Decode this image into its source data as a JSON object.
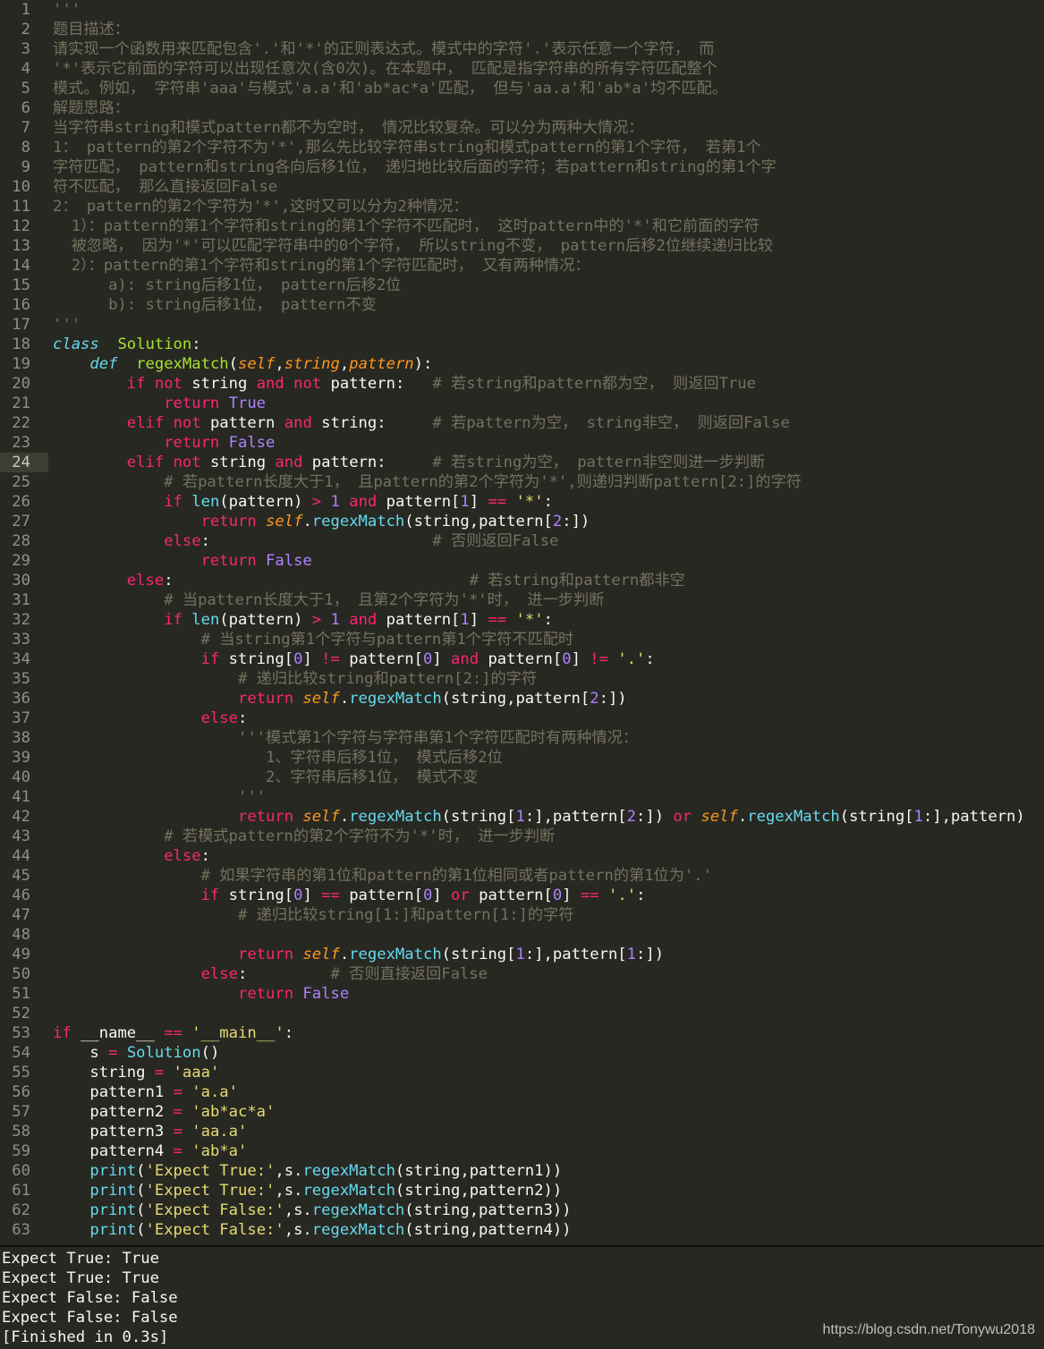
{
  "editor": {
    "current_line": 24,
    "lines": [
      [
        [
          "c",
          "'''"
        ]
      ],
      [
        [
          "c",
          "题目描述："
        ]
      ],
      [
        [
          "c",
          "请实现一个函数用来匹配包含'.'和'*'的正则表达式。模式中的字符'.'表示任意一个字符， 而"
        ]
      ],
      [
        [
          "c",
          "'*'表示它前面的字符可以出现任意次(含0次)。在本题中， 匹配是指字符串的所有字符匹配整个"
        ]
      ],
      [
        [
          "c",
          "模式。例如， 字符串'aaa'与模式'a.a'和'ab*ac*a'匹配， 但与'aa.a'和'ab*a'均不匹配。"
        ]
      ],
      [
        [
          "c",
          "解题思路："
        ]
      ],
      [
        [
          "c",
          "当字符串string和模式pattern都不为空时， 情况比较复杂。可以分为两种大情况："
        ]
      ],
      [
        [
          "c",
          "1： pattern的第2个字符不为'*',那么先比较字符串string和模式pattern的第1个字符， 若第1个"
        ]
      ],
      [
        [
          "c",
          "字符匹配， pattern和string各向后移1位， 递归地比较后面的字符；若pattern和string的第1个字"
        ]
      ],
      [
        [
          "c",
          "符不匹配， 那么直接返回False"
        ]
      ],
      [
        [
          "c",
          "2： pattern的第2个字符为'*',这时又可以分为2种情况："
        ]
      ],
      [
        [
          "c",
          "  1）：pattern的第1个字符和string的第1个字符不匹配时， 这时pattern中的'*'和它前面的字符"
        ]
      ],
      [
        [
          "c",
          "  被忽略， 因为'*'可以匹配字符串中的0个字符， 所以string不变， pattern后移2位继续递归比较"
        ]
      ],
      [
        [
          "c",
          "  2）：pattern的第1个字符和string的第1个字符匹配时， 又有两种情况："
        ]
      ],
      [
        [
          "c",
          "      a): string后移1位， pattern后移2位"
        ]
      ],
      [
        [
          "c",
          "      b): string后移1位， pattern不变"
        ]
      ],
      [
        [
          "c",
          "'''"
        ]
      ],
      [
        [
          "ki",
          "class"
        ],
        [
          "",
          "  "
        ],
        [
          "f",
          "Solution"
        ],
        [
          "",
          ":"
        ]
      ],
      [
        [
          "",
          "    "
        ],
        [
          "ki",
          "def"
        ],
        [
          "",
          "  "
        ],
        [
          "f",
          "regexMatch"
        ],
        [
          "",
          "("
        ],
        [
          "i",
          "self"
        ],
        [
          "",
          ","
        ],
        [
          "i",
          "string"
        ],
        [
          "",
          ","
        ],
        [
          "i",
          "pattern"
        ],
        [
          "",
          "):"
        ]
      ],
      [
        [
          "",
          "        "
        ],
        [
          "k",
          "if"
        ],
        [
          "",
          " "
        ],
        [
          "k",
          "not"
        ],
        [
          "",
          " string "
        ],
        [
          "k",
          "and"
        ],
        [
          "",
          " "
        ],
        [
          "k",
          "not"
        ],
        [
          "",
          " pattern:   "
        ],
        [
          "c",
          "# 若string和pattern都为空， 则返回True"
        ]
      ],
      [
        [
          "",
          "            "
        ],
        [
          "k",
          "return"
        ],
        [
          "",
          " "
        ],
        [
          "n",
          "True"
        ]
      ],
      [
        [
          "",
          "        "
        ],
        [
          "k",
          "elif"
        ],
        [
          "",
          " "
        ],
        [
          "k",
          "not"
        ],
        [
          "",
          " pattern "
        ],
        [
          "k",
          "and"
        ],
        [
          "",
          " string:     "
        ],
        [
          "c",
          "# 若pattern为空， string非空， 则返回False"
        ]
      ],
      [
        [
          "",
          "            "
        ],
        [
          "k",
          "return"
        ],
        [
          "",
          " "
        ],
        [
          "n",
          "False"
        ]
      ],
      [
        [
          "",
          "        "
        ],
        [
          "k",
          "elif"
        ],
        [
          "",
          " "
        ],
        [
          "k",
          "not"
        ],
        [
          "",
          " string "
        ],
        [
          "k",
          "and"
        ],
        [
          "",
          " pattern:     "
        ],
        [
          "c",
          "# 若string为空， pattern非空则进一步判断"
        ]
      ],
      [
        [
          "",
          "            "
        ],
        [
          "c",
          "# 若pattern长度大于1， 且pattern的第2个字符为'*',则递归判断pattern[2:]的字符"
        ]
      ],
      [
        [
          "",
          "            "
        ],
        [
          "k",
          "if"
        ],
        [
          "",
          " "
        ],
        [
          "b",
          "len"
        ],
        [
          "",
          "(pattern) "
        ],
        [
          "k",
          ">"
        ],
        [
          "",
          " "
        ],
        [
          "n",
          "1"
        ],
        [
          "",
          " "
        ],
        [
          "k",
          "and"
        ],
        [
          "",
          " pattern["
        ],
        [
          "n",
          "1"
        ],
        [
          "",
          "] "
        ],
        [
          "k",
          "=="
        ],
        [
          "",
          " "
        ],
        [
          "s",
          "'*'"
        ],
        [
          "",
          ":"
        ]
      ],
      [
        [
          "",
          "                "
        ],
        [
          "k",
          "return"
        ],
        [
          "",
          " "
        ],
        [
          "i",
          "self"
        ],
        [
          "",
          "."
        ],
        [
          "b",
          "regexMatch"
        ],
        [
          "",
          "(string,pattern["
        ],
        [
          "n",
          "2"
        ],
        [
          "",
          ":])"
        ]
      ],
      [
        [
          "",
          "            "
        ],
        [
          "k",
          "else"
        ],
        [
          "",
          ":                        "
        ],
        [
          "c",
          "# 否则返回False"
        ]
      ],
      [
        [
          "",
          "                "
        ],
        [
          "k",
          "return"
        ],
        [
          "",
          " "
        ],
        [
          "n",
          "False"
        ]
      ],
      [
        [
          "",
          "        "
        ],
        [
          "k",
          "else"
        ],
        [
          "",
          ":                                "
        ],
        [
          "c",
          "# 若string和pattern都非空"
        ]
      ],
      [
        [
          "",
          "            "
        ],
        [
          "c",
          "# 当pattern长度大于1， 且第2个字符为'*'时， 进一步判断"
        ]
      ],
      [
        [
          "",
          "            "
        ],
        [
          "k",
          "if"
        ],
        [
          "",
          " "
        ],
        [
          "b",
          "len"
        ],
        [
          "",
          "(pattern) "
        ],
        [
          "k",
          ">"
        ],
        [
          "",
          " "
        ],
        [
          "n",
          "1"
        ],
        [
          "",
          " "
        ],
        [
          "k",
          "and"
        ],
        [
          "",
          " pattern["
        ],
        [
          "n",
          "1"
        ],
        [
          "",
          "] "
        ],
        [
          "k",
          "=="
        ],
        [
          "",
          " "
        ],
        [
          "s",
          "'*'"
        ],
        [
          "",
          ":"
        ]
      ],
      [
        [
          "",
          "                "
        ],
        [
          "c",
          "# 当string第1个字符与pattern第1个字符不匹配时"
        ]
      ],
      [
        [
          "",
          "                "
        ],
        [
          "k",
          "if"
        ],
        [
          "",
          " string["
        ],
        [
          "n",
          "0"
        ],
        [
          "",
          "] "
        ],
        [
          "k",
          "!="
        ],
        [
          "",
          " pattern["
        ],
        [
          "n",
          "0"
        ],
        [
          "",
          "] "
        ],
        [
          "k",
          "and"
        ],
        [
          "",
          " pattern["
        ],
        [
          "n",
          "0"
        ],
        [
          "",
          "] "
        ],
        [
          "k",
          "!="
        ],
        [
          "",
          " "
        ],
        [
          "s",
          "'.'"
        ],
        [
          "",
          ":"
        ]
      ],
      [
        [
          "",
          "                    "
        ],
        [
          "c",
          "# 递归比较string和pattern[2:]的字符"
        ]
      ],
      [
        [
          "",
          "                    "
        ],
        [
          "k",
          "return"
        ],
        [
          "",
          " "
        ],
        [
          "i",
          "self"
        ],
        [
          "",
          "."
        ],
        [
          "b",
          "regexMatch"
        ],
        [
          "",
          "(string,pattern["
        ],
        [
          "n",
          "2"
        ],
        [
          "",
          ":])"
        ]
      ],
      [
        [
          "",
          "                "
        ],
        [
          "k",
          "else"
        ],
        [
          "",
          ":"
        ]
      ],
      [
        [
          "",
          "                    "
        ],
        [
          "c",
          "'''模式第1个字符与字符串第1个字符匹配时有两种情况："
        ]
      ],
      [
        [
          "",
          "                       "
        ],
        [
          "c",
          "1、字符串后移1位， 模式后移2位"
        ]
      ],
      [
        [
          "",
          "                       "
        ],
        [
          "c",
          "2、字符串后移1位， 模式不变"
        ]
      ],
      [
        [
          "",
          "                    "
        ],
        [
          "c",
          "'''"
        ]
      ],
      [
        [
          "",
          "                    "
        ],
        [
          "k",
          "return"
        ],
        [
          "",
          " "
        ],
        [
          "i",
          "self"
        ],
        [
          "",
          "."
        ],
        [
          "b",
          "regexMatch"
        ],
        [
          "",
          "(string["
        ],
        [
          "n",
          "1"
        ],
        [
          "",
          ":],pattern["
        ],
        [
          "n",
          "2"
        ],
        [
          "",
          ":]) "
        ],
        [
          "k",
          "or"
        ],
        [
          "",
          " "
        ],
        [
          "i",
          "self"
        ],
        [
          "",
          "."
        ],
        [
          "b",
          "regexMatch"
        ],
        [
          "",
          "(string["
        ],
        [
          "n",
          "1"
        ],
        [
          "",
          ":],pattern)"
        ]
      ],
      [
        [
          "",
          "            "
        ],
        [
          "c",
          "# 若模式pattern的第2个字符不为'*'时， 进一步判断"
        ]
      ],
      [
        [
          "",
          "            "
        ],
        [
          "k",
          "else"
        ],
        [
          "",
          ":"
        ]
      ],
      [
        [
          "",
          "                "
        ],
        [
          "c",
          "# 如果字符串的第1位和pattern的第1位相同或者pattern的第1位为'.'"
        ]
      ],
      [
        [
          "",
          "                "
        ],
        [
          "k",
          "if"
        ],
        [
          "",
          " string["
        ],
        [
          "n",
          "0"
        ],
        [
          "",
          "] "
        ],
        [
          "k",
          "=="
        ],
        [
          "",
          " pattern["
        ],
        [
          "n",
          "0"
        ],
        [
          "",
          "] "
        ],
        [
          "k",
          "or"
        ],
        [
          "",
          " pattern["
        ],
        [
          "n",
          "0"
        ],
        [
          "",
          "] "
        ],
        [
          "k",
          "=="
        ],
        [
          "",
          " "
        ],
        [
          "s",
          "'.'"
        ],
        [
          "",
          ":"
        ]
      ],
      [
        [
          "",
          "                    "
        ],
        [
          "c",
          "# 递归比较string[1:]和pattern[1:]的字符"
        ]
      ],
      [],
      [
        [
          "",
          "                    "
        ],
        [
          "k",
          "return"
        ],
        [
          "",
          " "
        ],
        [
          "i",
          "self"
        ],
        [
          "",
          "."
        ],
        [
          "b",
          "regexMatch"
        ],
        [
          "",
          "(string["
        ],
        [
          "n",
          "1"
        ],
        [
          "",
          ":],pattern["
        ],
        [
          "n",
          "1"
        ],
        [
          "",
          ":])"
        ]
      ],
      [
        [
          "",
          "                "
        ],
        [
          "k",
          "else"
        ],
        [
          "",
          ":         "
        ],
        [
          "c",
          "# 否则直接返回False"
        ]
      ],
      [
        [
          "",
          "                    "
        ],
        [
          "k",
          "return"
        ],
        [
          "",
          " "
        ],
        [
          "n",
          "False"
        ]
      ],
      [],
      [
        [
          "k",
          "if"
        ],
        [
          "",
          " __name__ "
        ],
        [
          "k",
          "=="
        ],
        [
          "",
          " "
        ],
        [
          "s",
          "'__main__'"
        ],
        [
          "",
          ":"
        ]
      ],
      [
        [
          "",
          "    s "
        ],
        [
          "k",
          "="
        ],
        [
          "",
          " "
        ],
        [
          "b",
          "Solution"
        ],
        [
          "",
          "()"
        ]
      ],
      [
        [
          "",
          "    string "
        ],
        [
          "k",
          "="
        ],
        [
          "",
          " "
        ],
        [
          "s",
          "'aaa'"
        ]
      ],
      [
        [
          "",
          "    pattern1 "
        ],
        [
          "k",
          "="
        ],
        [
          "",
          " "
        ],
        [
          "s",
          "'a.a'"
        ]
      ],
      [
        [
          "",
          "    pattern2 "
        ],
        [
          "k",
          "="
        ],
        [
          "",
          " "
        ],
        [
          "s",
          "'ab*ac*a'"
        ]
      ],
      [
        [
          "",
          "    pattern3 "
        ],
        [
          "k",
          "="
        ],
        [
          "",
          " "
        ],
        [
          "s",
          "'aa.a'"
        ]
      ],
      [
        [
          "",
          "    pattern4 "
        ],
        [
          "k",
          "="
        ],
        [
          "",
          " "
        ],
        [
          "s",
          "'ab*a'"
        ]
      ],
      [
        [
          "",
          "    "
        ],
        [
          "b",
          "print"
        ],
        [
          "",
          "("
        ],
        [
          "s",
          "'Expect True:'"
        ],
        [
          "",
          ",s."
        ],
        [
          "b",
          "regexMatch"
        ],
        [
          "",
          "(string,pattern1))"
        ]
      ],
      [
        [
          "",
          "    "
        ],
        [
          "b",
          "print"
        ],
        [
          "",
          "("
        ],
        [
          "s",
          "'Expect True:'"
        ],
        [
          "",
          ",s."
        ],
        [
          "b",
          "regexMatch"
        ],
        [
          "",
          "(string,pattern2))"
        ]
      ],
      [
        [
          "",
          "    "
        ],
        [
          "b",
          "print"
        ],
        [
          "",
          "("
        ],
        [
          "s",
          "'Expect False:'"
        ],
        [
          "",
          ",s."
        ],
        [
          "b",
          "regexMatch"
        ],
        [
          "",
          "(string,pattern3))"
        ]
      ],
      [
        [
          "",
          "    "
        ],
        [
          "b",
          "print"
        ],
        [
          "",
          "("
        ],
        [
          "s",
          "'Expect False:'"
        ],
        [
          "",
          ",s."
        ],
        [
          "b",
          "regexMatch"
        ],
        [
          "",
          "(string,pattern4))"
        ]
      ]
    ]
  },
  "output": {
    "lines": [
      "Expect True: True",
      "Expect True: True",
      "Expect False: False",
      "Expect False: False",
      "[Finished in 0.3s]"
    ]
  },
  "watermark": "https://blog.csdn.net/Tonywu2018"
}
